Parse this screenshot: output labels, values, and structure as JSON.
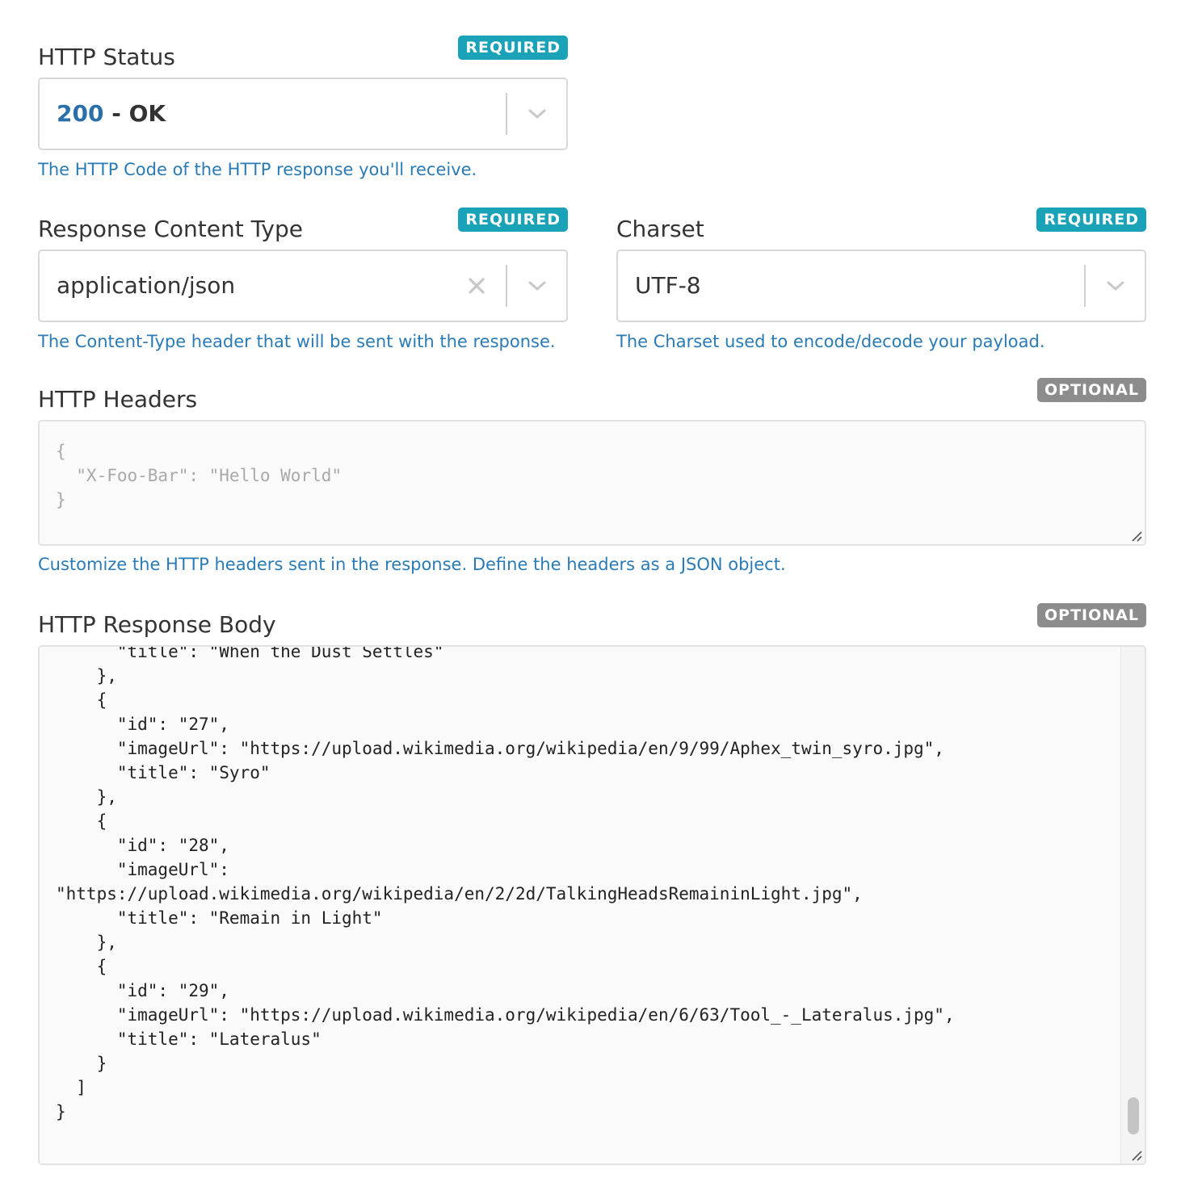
{
  "status": {
    "label": "HTTP Status",
    "badge": "REQUIRED",
    "code": "200",
    "separator": " - ",
    "text": "OK",
    "help": "The HTTP Code of the HTTP response you'll receive."
  },
  "content_type": {
    "label": "Response Content Type",
    "badge": "REQUIRED",
    "value": "application/json",
    "help": "The Content-Type header that will be sent with the response."
  },
  "charset": {
    "label": "Charset",
    "badge": "REQUIRED",
    "value": "UTF-8",
    "help": "The Charset used to encode/decode your payload."
  },
  "headers": {
    "label": "HTTP Headers",
    "badge": "OPTIONAL",
    "placeholder": "{\n  \"X-Foo-Bar\": \"Hello World\"\n}",
    "help": "Customize the HTTP headers sent in the response. Define the headers as a JSON object."
  },
  "body": {
    "label": "HTTP Response Body",
    "badge": "OPTIONAL",
    "value": "      \"title\": \"When the Dust Settles\"\n    },\n    {\n      \"id\": \"27\",\n      \"imageUrl\": \"https://upload.wikimedia.org/wikipedia/en/9/99/Aphex_twin_syro.jpg\",\n      \"title\": \"Syro\"\n    },\n    {\n      \"id\": \"28\",\n      \"imageUrl\":\n\"https://upload.wikimedia.org/wikipedia/en/2/2d/TalkingHeadsRemaininLight.jpg\",\n      \"title\": \"Remain in Light\"\n    },\n    {\n      \"id\": \"29\",\n      \"imageUrl\": \"https://upload.wikimedia.org/wikipedia/en/6/63/Tool_-_Lateralus.jpg\",\n      \"title\": \"Lateralus\"\n    }\n  ]\n}"
  },
  "icons": {
    "dropdown": "chevron-down-icon",
    "clear": "close-icon",
    "resize": "resize-handle-icon"
  },
  "colors": {
    "required_badge": "#1aa3b8",
    "optional_badge": "#8c8c8c",
    "help_text": "#2a7bb5",
    "status_code": "#2a6fa8"
  }
}
